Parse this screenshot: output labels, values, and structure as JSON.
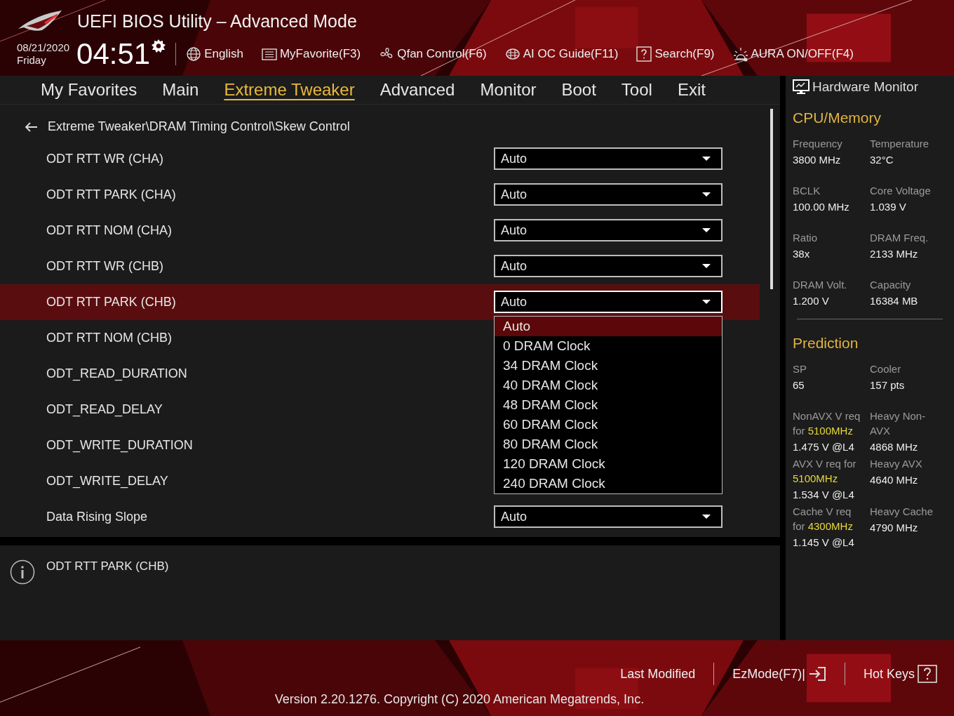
{
  "header": {
    "title": "UEFI BIOS Utility – Advanced Mode",
    "date": "08/21/2020",
    "day": "Friday",
    "time": "04:51",
    "tools": [
      {
        "kind": "language",
        "label": "English"
      },
      {
        "kind": "favorite",
        "label": "MyFavorite(F3)"
      },
      {
        "kind": "fan",
        "label": "Qfan Control(F6)"
      },
      {
        "kind": "ai",
        "label": "AI OC Guide(F11)"
      },
      {
        "kind": "search",
        "label": "Search(F9)"
      },
      {
        "kind": "aura",
        "label": "AURA ON/OFF(F4)"
      }
    ]
  },
  "tabs": [
    {
      "label": "My Favorites",
      "selected": false
    },
    {
      "label": "Main",
      "selected": false
    },
    {
      "label": "Extreme Tweaker",
      "selected": true
    },
    {
      "label": "Advanced",
      "selected": false
    },
    {
      "label": "Monitor",
      "selected": false
    },
    {
      "label": "Boot",
      "selected": false
    },
    {
      "label": "Tool",
      "selected": false
    },
    {
      "label": "Exit",
      "selected": false
    }
  ],
  "breadcrumb": "Extreme Tweaker\\DRAM Timing Control\\Skew Control",
  "settings": [
    {
      "label": "ODT RTT WR (CHA)",
      "value": "Auto",
      "selected": false
    },
    {
      "label": "ODT RTT PARK (CHA)",
      "value": "Auto",
      "selected": false
    },
    {
      "label": "ODT RTT NOM (CHA)",
      "value": "Auto",
      "selected": false
    },
    {
      "label": "ODT RTT WR (CHB)",
      "value": "Auto",
      "selected": false
    },
    {
      "label": "ODT RTT PARK (CHB)",
      "value": "Auto",
      "selected": true
    },
    {
      "label": "ODT RTT NOM (CHB)",
      "selected": false
    },
    {
      "label": "ODT_READ_DURATION",
      "selected": false
    },
    {
      "label": "ODT_READ_DELAY",
      "selected": false
    },
    {
      "label": "ODT_WRITE_DURATION",
      "selected": false
    },
    {
      "label": "ODT_WRITE_DELAY",
      "selected": false
    },
    {
      "label": "Data Rising Slope",
      "value": "Auto",
      "selected": false
    }
  ],
  "dropdown": {
    "options": [
      {
        "label": "Auto",
        "selected": true
      },
      {
        "label": "0 DRAM Clock",
        "selected": false
      },
      {
        "label": "34 DRAM Clock",
        "selected": false
      },
      {
        "label": "40 DRAM Clock",
        "selected": false
      },
      {
        "label": "48 DRAM Clock",
        "selected": false
      },
      {
        "label": "60 DRAM Clock",
        "selected": false
      },
      {
        "label": "80 DRAM Clock",
        "selected": false
      },
      {
        "label": "120 DRAM Clock",
        "selected": false
      },
      {
        "label": "240 DRAM Clock",
        "selected": false
      }
    ]
  },
  "help": "ODT RTT PARK (CHB)",
  "hardware_monitor": {
    "title": "Hardware Monitor",
    "sections": [
      {
        "title": "CPU/Memory",
        "items": [
          {
            "label": "Frequency",
            "value": "3800 MHz"
          },
          {
            "label": "Temperature",
            "value": "32°C"
          },
          {
            "label": "BCLK",
            "value": "100.00 MHz"
          },
          {
            "label": "Core Voltage",
            "value": "1.039 V"
          },
          {
            "label": "Ratio",
            "value": "38x"
          },
          {
            "label": "DRAM Freq.",
            "value": "2133 MHz"
          },
          {
            "label": "DRAM Volt.",
            "value": "1.200 V"
          },
          {
            "label": "Capacity",
            "value": "16384 MB"
          }
        ]
      },
      {
        "title": "Prediction",
        "items": [
          {
            "label": "SP",
            "value": "65"
          },
          {
            "label": "Cooler",
            "value": "157 pts"
          },
          {
            "label": "NonAVX V req for **5100MHz**",
            "value": "1.475 V @L4"
          },
          {
            "label": "Heavy Non-AVX",
            "value": "4868 MHz"
          },
          {
            "label": "AVX V req for **5100MHz**",
            "value": "1.534 V @L4"
          },
          {
            "label": "Heavy AVX",
            "value": "4640 MHz"
          },
          {
            "label": "Cache V req for **4300MHz**",
            "value": "1.145 V @L4"
          },
          {
            "label": "Heavy Cache",
            "value": "4790 MHz"
          }
        ]
      }
    ]
  },
  "footer": {
    "actions": [
      {
        "kind": "last",
        "label": "Last Modified"
      },
      {
        "kind": "ezmode",
        "label": "EzMode(F7)|"
      },
      {
        "kind": "hotkeys",
        "label": "Hot Keys"
      }
    ],
    "version": "Version 2.20.1276. Copyright (C) 2020 American Megatrends, Inc."
  }
}
